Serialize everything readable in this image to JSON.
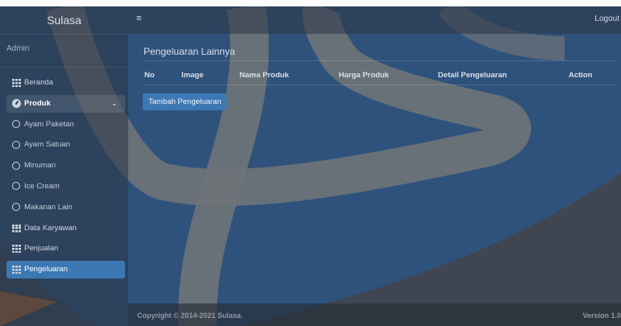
{
  "brand": "Sulasa",
  "user": "Admin",
  "header": {
    "menu_icon": "≡",
    "logout": "Logout"
  },
  "menu": {
    "beranda": "Beranda",
    "produk": "Produk",
    "ayam_paketan": "Ayam Paketan",
    "ayam_satuan": "Ayam Satuan",
    "minuman": "Minuman",
    "ice_cream": "Ice Cream",
    "makanan_lain": "Makanan Lain",
    "data_karyawan": "Data Karyawan",
    "penjualan": "Penjualan",
    "pengeluaran": "Pengeluaran"
  },
  "page": {
    "title": "Pengeluaran Lainnya",
    "columns": [
      "No",
      "Image",
      "Nama Produk",
      "Harga Produk",
      "Detail Pengeluaran",
      "Action"
    ],
    "add_button": "Tambah Pengeluaran"
  },
  "footer": {
    "copyright": "Copyright © 2014-2021 Sulasa.",
    "version": "Version 1.0"
  },
  "colors": {
    "accent": "#3c78b4",
    "watermark_blue": "#2f5a8c",
    "watermark_orange": "#e8741e"
  }
}
